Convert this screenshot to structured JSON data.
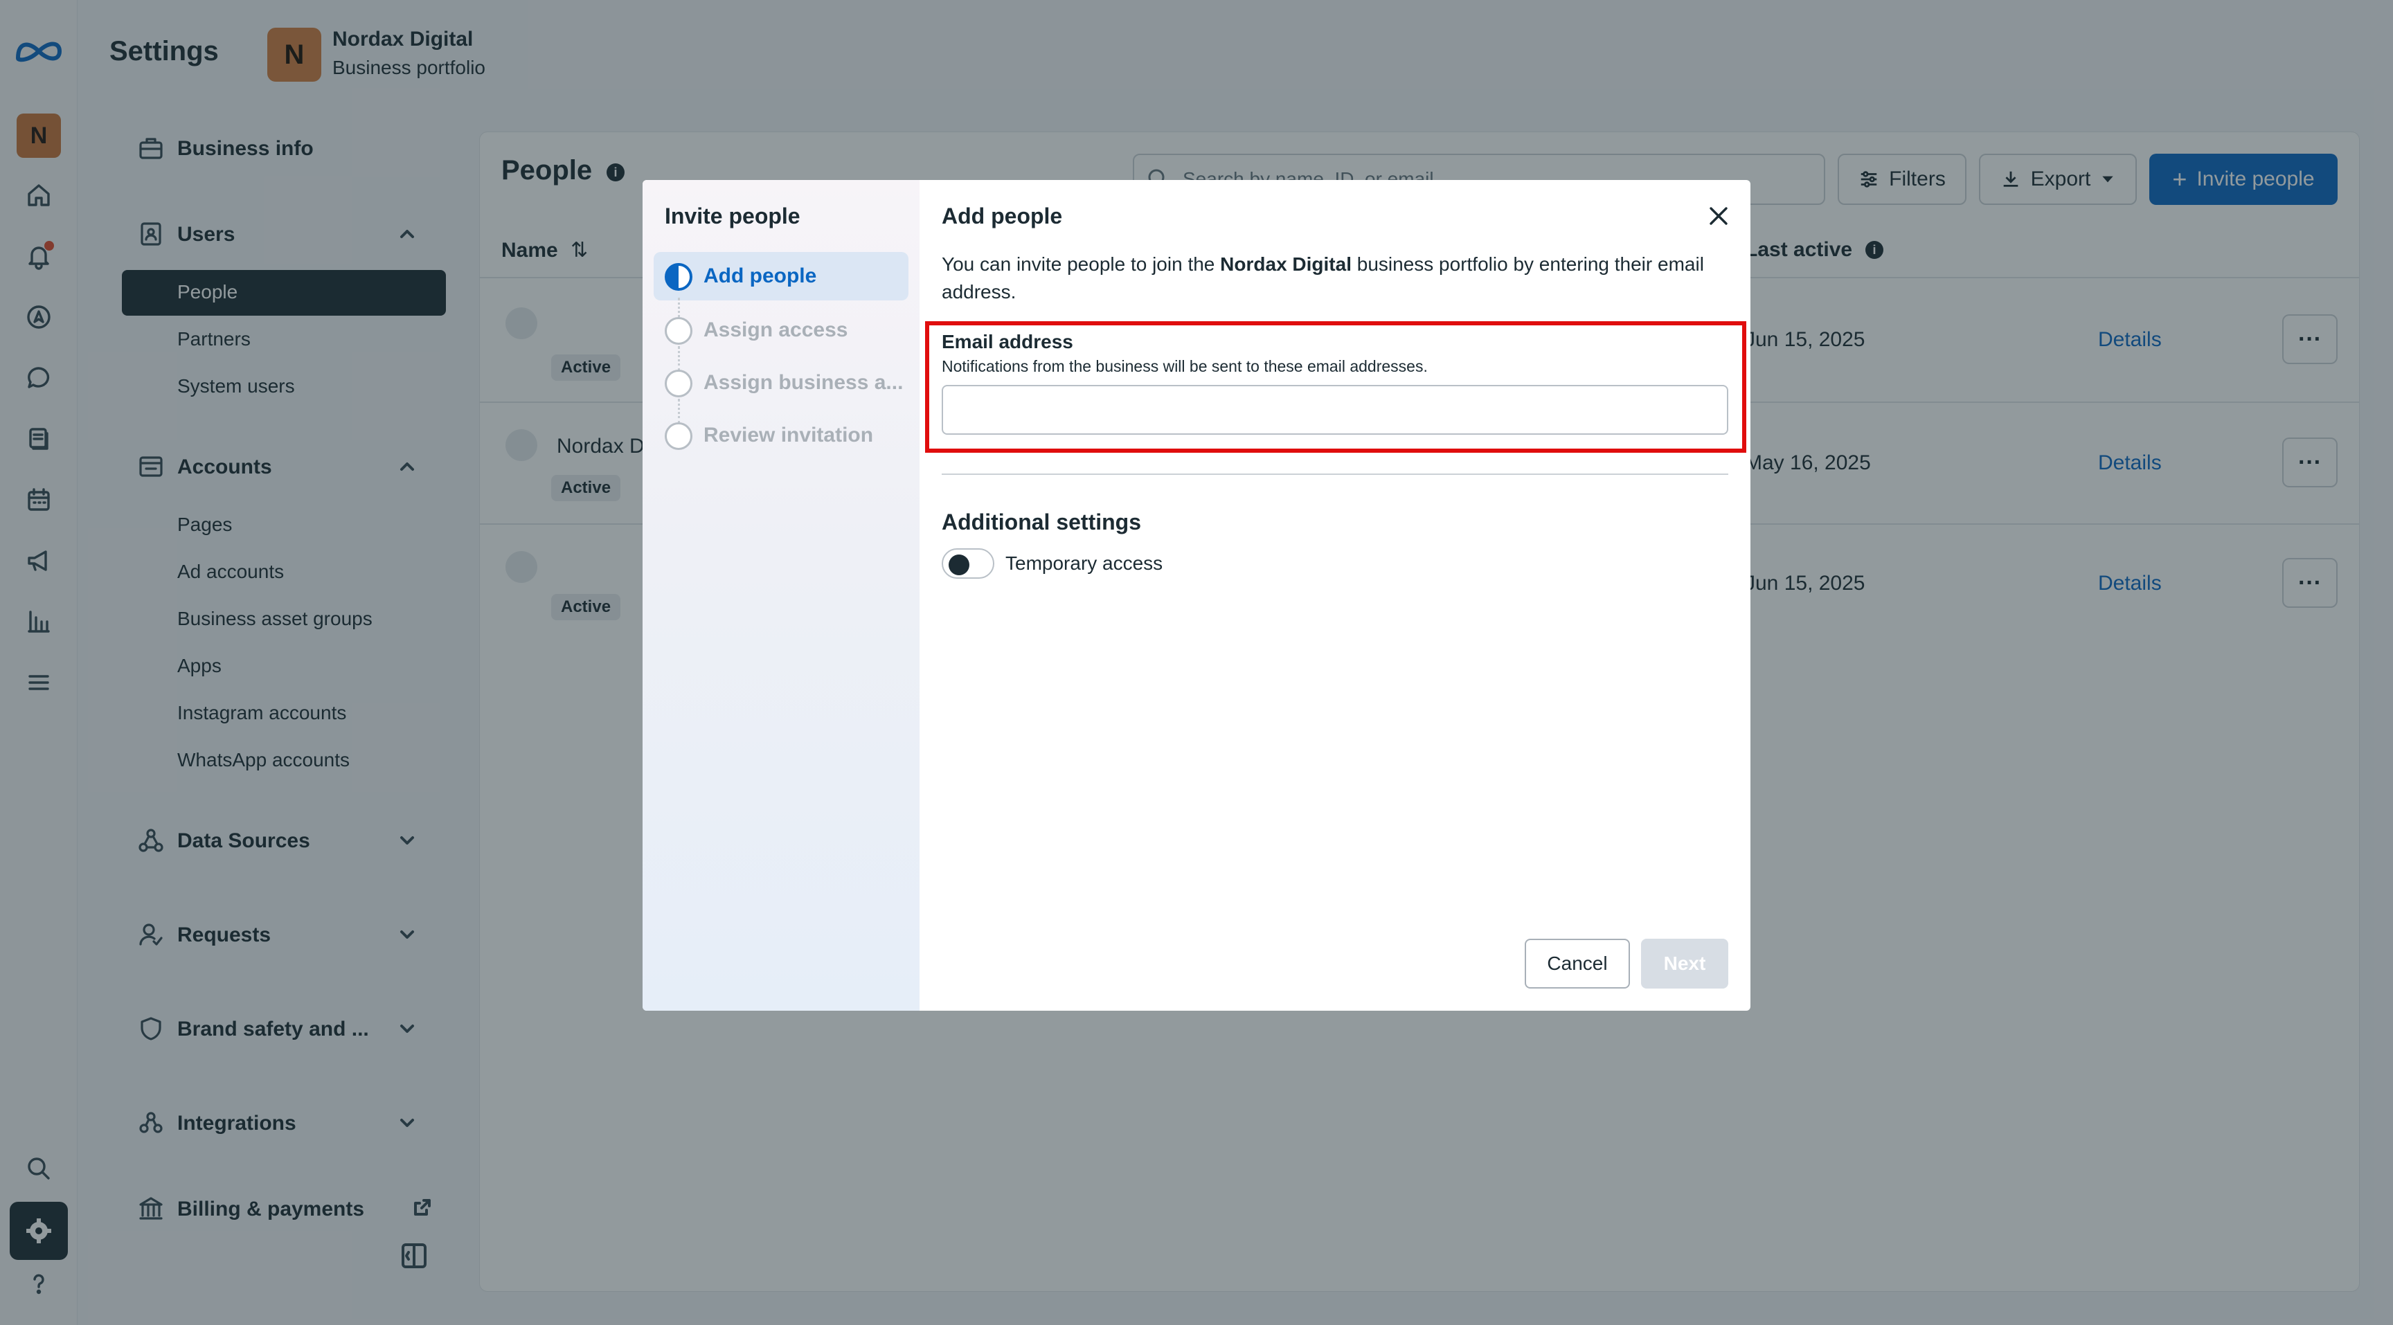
{
  "header": {
    "settings_title": "Settings",
    "business_initial": "N",
    "business_name": "Nordax Digital",
    "business_subtitle": "Business portfolio"
  },
  "rail": {
    "avatar_initial": "N",
    "icons": [
      "meta-logo-icon",
      "home-icon",
      "bell-icon",
      "compass-icon",
      "chat-icon",
      "pages-icon",
      "calendar-icon",
      "megaphone-icon",
      "analytics-icon",
      "menu-icon",
      "search-icon",
      "gear-icon",
      "help-icon"
    ]
  },
  "nav": {
    "business_info": "Business info",
    "users": "Users",
    "people": "People",
    "partners": "Partners",
    "system_users": "System users",
    "accounts": "Accounts",
    "pages": "Pages",
    "ad_accounts": "Ad accounts",
    "business_asset_groups": "Business asset groups",
    "apps": "Apps",
    "instagram_accounts": "Instagram accounts",
    "whatsapp_accounts": "WhatsApp accounts",
    "data_sources": "Data Sources",
    "requests": "Requests",
    "brand_safety": "Brand safety and ...",
    "integrations": "Integrations",
    "billing": "Billing & payments"
  },
  "main": {
    "title": "People",
    "search_placeholder": "Search by name, ID, or email",
    "filters": "Filters",
    "export": "Export",
    "invite": "Invite people",
    "col_name": "Name",
    "col_last_active": "Last active",
    "rows": [
      {
        "name": "",
        "status": "Active",
        "last_active": "Jun 15, 2025",
        "details": "Details"
      },
      {
        "name": "Nordax D",
        "status": "Active",
        "last_active": "May 16, 2025",
        "details": "Details"
      },
      {
        "name": "",
        "status": "Active",
        "last_active": "Jun 15, 2025",
        "details": "Details"
      }
    ]
  },
  "modal": {
    "sidebar_title": "Invite people",
    "steps": [
      "Add people",
      "Assign access",
      "Assign business a...",
      "Review invitation"
    ],
    "title": "Add people",
    "desc_pre": "You can invite people to join the ",
    "desc_bold": "Nordax Digital",
    "desc_post": " business portfolio by entering their email address.",
    "email_label": "Email address",
    "email_hint": "Notifications from the business will be sent to these email addresses.",
    "email_value": "",
    "additional_settings": "Additional settings",
    "temporary_access": "Temporary access",
    "cancel": "Cancel",
    "next": "Next"
  },
  "colors": {
    "accent": "#0a66c2",
    "highlight": "#e00d0d",
    "dark": "#1c2b33"
  }
}
